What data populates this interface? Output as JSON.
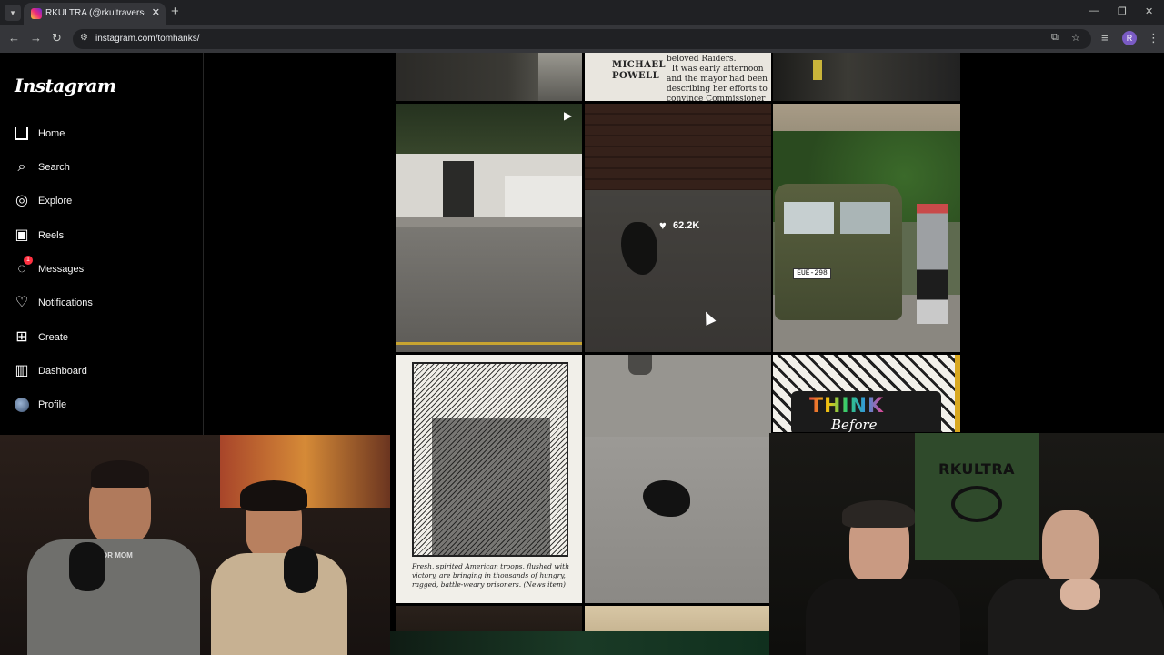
{
  "browser": {
    "tab_title": "RKULTRA (@rkultraverse) • Insta",
    "url": "instagram.com/tomhanks/",
    "profile_initial": "R"
  },
  "sidebar": {
    "logo": "Instagram",
    "items": [
      {
        "label": "Home",
        "icon": "home-icon"
      },
      {
        "label": "Search",
        "icon": "search-icon"
      },
      {
        "label": "Explore",
        "icon": "compass-icon"
      },
      {
        "label": "Reels",
        "icon": "reels-icon"
      },
      {
        "label": "Messages",
        "icon": "messenger-icon",
        "badge": "1"
      },
      {
        "label": "Notifications",
        "icon": "heart-icon"
      },
      {
        "label": "Create",
        "icon": "plus-square-icon"
      },
      {
        "label": "Dashboard",
        "icon": "chart-icon"
      },
      {
        "label": "Profile",
        "icon": "avatar-icon"
      }
    ]
  },
  "posts": {
    "newspaper": {
      "byline": "MICHAEL\nPOWELL",
      "text": "beloved Raiders.\n  It was early afternoon\nand the mayor had been\ndescribing her efforts to\nconvince Commissioner"
    },
    "glove_sidewalk": {
      "likes": "62.2K"
    },
    "van": {
      "plate": "EUE-298"
    },
    "drawing": {
      "caption": "Fresh, spirited American troops, flushed with victory, are bringing in thousands of hungry, ragged, battle-weary prisoners. (News item)"
    },
    "sign": {
      "line1": "THINK",
      "line2": "Before"
    }
  },
  "webcam_right": {
    "banner": "RKULTRA"
  },
  "webcam_left": {
    "shirt": "OR MOM"
  },
  "colors": {
    "background": "#000000",
    "badge": "#ff3040",
    "instagram_gradient": [
      "#f9ce34",
      "#ee2a7b",
      "#6228d7"
    ]
  }
}
